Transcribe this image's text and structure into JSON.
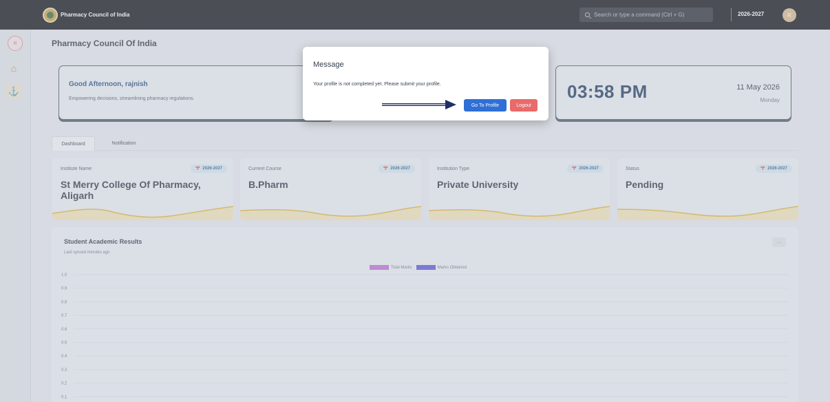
{
  "topbar": {
    "brand": "Pharmacy Council of India",
    "search_placeholder": "Search or type a command (Ctrl + G)",
    "year": "2026-2027",
    "avatar_initial": "R"
  },
  "sidebar": {
    "avatar_initial": "R",
    "items": [
      {
        "icon": "home-icon"
      },
      {
        "icon": "anchor-icon"
      }
    ]
  },
  "page": {
    "title": "Pharmacy Council Of India"
  },
  "greeting": {
    "title": "Good Afternoon, rajnish",
    "subtitle": "Empowering decisions, streamlining pharmacy regulations."
  },
  "clock": {
    "time": "03:58 PM",
    "date": "11 May 2026",
    "day": "Monday"
  },
  "tabs": [
    "Dashboard",
    "Notification"
  ],
  "stats": [
    {
      "label": "Institute Name",
      "badge": "2026-2027",
      "value": "St Merry College Of Pharmacy, Aligarh"
    },
    {
      "label": "Current Course",
      "badge": "2026-2027",
      "value": "B.Pharm"
    },
    {
      "label": "Institution Type",
      "badge": "2026-2027",
      "value": "Private University"
    },
    {
      "label": "Status",
      "badge": "2026-2027",
      "value": "Pending"
    }
  ],
  "results": {
    "title": "Student Academic Results",
    "subtitle": "Last synced minutes ago",
    "more_label": "···"
  },
  "chart_data": {
    "type": "bar",
    "title": "",
    "xlabel": "",
    "ylabel": "",
    "ylim": [
      0,
      1
    ],
    "categories": [],
    "y_ticks": [
      "1.0",
      "0.9",
      "0.8",
      "0.7",
      "0.6",
      "0.5",
      "0.4",
      "0.3",
      "0.2",
      "0.1"
    ],
    "series": [
      {
        "name": "Total Marks",
        "color": "#c36ad6",
        "values": []
      },
      {
        "name": "Marks Obtained",
        "color": "#5757d6",
        "values": []
      }
    ],
    "legend": "top-center",
    "grid": true
  },
  "modal": {
    "title": "Message",
    "message": "Your profile is not completed yet. Please submit your profile.",
    "primary_label": "Go To Profile",
    "secondary_label": "Logout"
  },
  "colors": {
    "topbar": "#0f1115",
    "accent_blue": "#2f6fd6",
    "accent_red": "#e86a6a",
    "wave": "#e0b43a"
  }
}
